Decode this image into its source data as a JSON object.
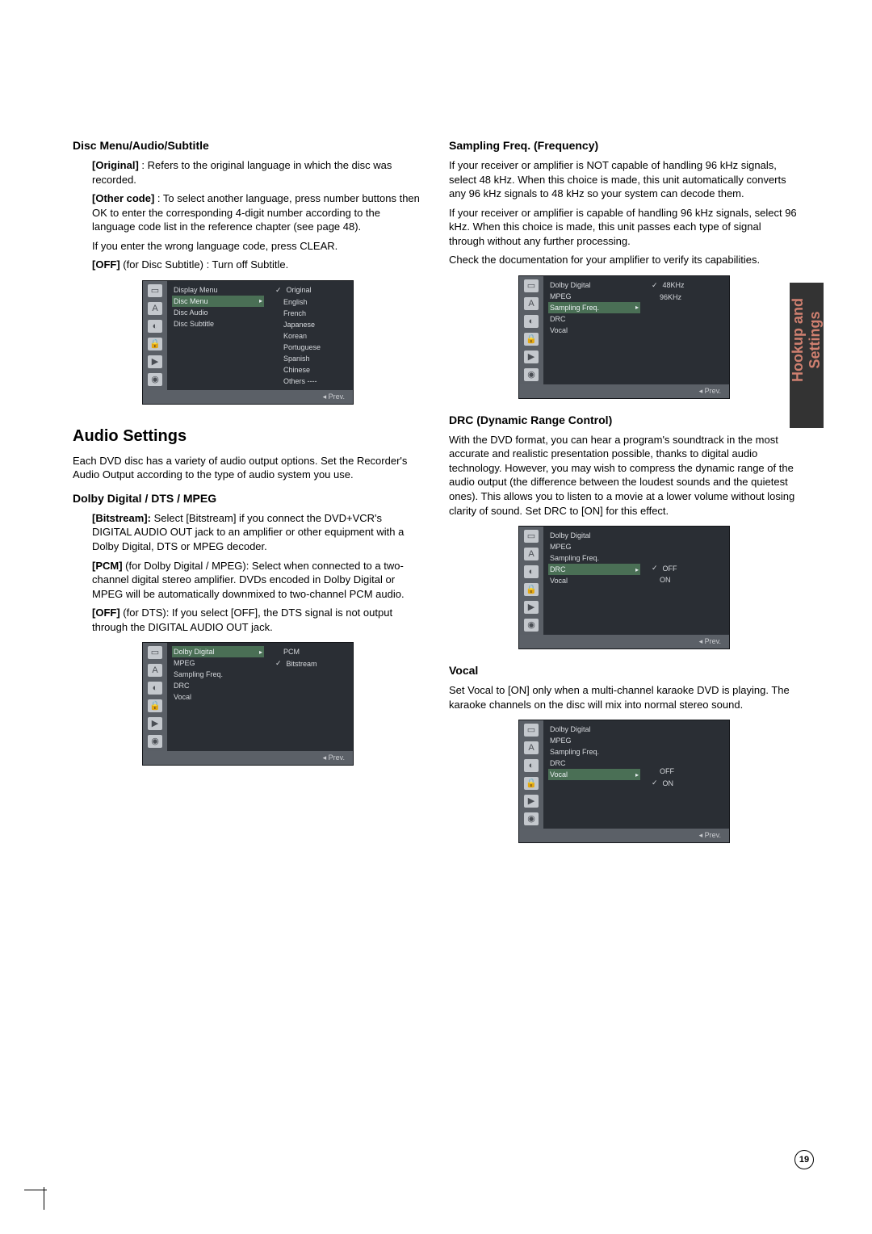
{
  "side_tab": {
    "line1": "Hookup and",
    "line2": "Settings"
  },
  "page_number": "19",
  "left": {
    "disc_menu": {
      "heading": "Disc Menu/Audio/Subtitle",
      "original_label": "[Original]",
      "original_text": " : Refers to the original language in which the disc was recorded.",
      "other_label": "[Other code]",
      "other_text": " : To select another language, press number buttons then OK to enter the corresponding 4-digit number according to the language code list in the reference chapter (see page 48).",
      "wrong_text": "If you enter the wrong language code, press CLEAR.",
      "off_label": "[OFF]",
      "off_text": " (for Disc Subtitle) : Turn off Subtitle."
    },
    "audio_settings": {
      "heading": "Audio Settings",
      "intro": "Each DVD disc has a variety of audio output options. Set the Recorder's Audio Output according to the type of audio system you use."
    },
    "dolby": {
      "heading": "Dolby Digital / DTS / MPEG",
      "bitstream_label": "[Bitstream]:",
      "bitstream_text": " Select [Bitstream] if you connect the DVD+VCR's DIGITAL AUDIO OUT jack to an amplifier or other equipment with a Dolby Digital, DTS or MPEG decoder.",
      "pcm_label": "[PCM]",
      "pcm_text": " (for Dolby Digital / MPEG): Select when connected to a two-channel digital stereo amplifier. DVDs encoded in Dolby Digital or MPEG will be automatically downmixed to two-channel PCM audio.",
      "off_label": "[OFF]",
      "off_text": " (for DTS): If you select [OFF], the DTS signal is not output through the DIGITAL AUDIO OUT jack."
    }
  },
  "right": {
    "sampling": {
      "heading": "Sampling Freq. (Frequency)",
      "p1": "If your receiver or amplifier is NOT capable of handling 96 kHz signals, select 48 kHz. When this choice is made, this unit automatically converts any 96 kHz signals to 48 kHz so your system can decode them.",
      "p2": "If your receiver or amplifier is capable of handling 96 kHz signals, select 96 kHz. When this choice is made, this unit passes each type of signal through without any further processing.",
      "p3": "Check the documentation for your amplifier to verify its capabilities."
    },
    "drc": {
      "heading": "DRC (Dynamic Range Control)",
      "p": "With the DVD format, you can hear a program's soundtrack in the most accurate and realistic presentation possible, thanks to digital audio technology. However, you may wish to compress the dynamic range of the audio output (the difference between the loudest sounds and the quietest ones). This allows you to listen to a movie at a lower volume without losing clarity of sound. Set DRC to [ON] for this effect."
    },
    "vocal": {
      "heading": "Vocal",
      "p": "Set Vocal to [ON] only when a multi-channel karaoke DVD is playing. The karaoke channels on the disc will mix into normal stereo sound."
    }
  },
  "osd_icons": [
    "▭",
    "A",
    "◐",
    "🔒",
    "▶",
    "◉"
  ],
  "osd_prev": "◂ Prev.",
  "osd1": {
    "mid": [
      "Display Menu",
      "Disc Menu",
      "Disc Audio",
      "Disc Subtitle"
    ],
    "mid_sel_index": 1,
    "right": [
      "Original",
      "English",
      "French",
      "Japanese",
      "Korean",
      "Portuguese",
      "Spanish",
      "Chinese",
      "Others ----"
    ],
    "right_sel_index": 0
  },
  "osd2": {
    "mid": [
      "Dolby Digital",
      "MPEG",
      "Sampling Freq.",
      "DRC",
      "Vocal"
    ],
    "mid_sel_index": 0,
    "right": [
      "PCM",
      "Bitstream"
    ],
    "right_sel_index": 1
  },
  "osd3": {
    "mid": [
      "Dolby Digital",
      "MPEG",
      "Sampling Freq.",
      "DRC",
      "Vocal"
    ],
    "mid_sel_index": 2,
    "right": [
      "48KHz",
      "96KHz"
    ],
    "right_sel_index": 0
  },
  "osd4": {
    "mid": [
      "Dolby Digital",
      "MPEG",
      "Sampling Freq.",
      "DRC",
      "Vocal"
    ],
    "mid_sel_index": 3,
    "right": [
      "OFF",
      "ON"
    ],
    "right_sel_index": 0
  },
  "osd5": {
    "mid": [
      "Dolby Digital",
      "MPEG",
      "Sampling Freq.",
      "DRC",
      "Vocal"
    ],
    "mid_sel_index": 4,
    "right": [
      "OFF",
      "ON"
    ],
    "right_sel_index": 1
  }
}
